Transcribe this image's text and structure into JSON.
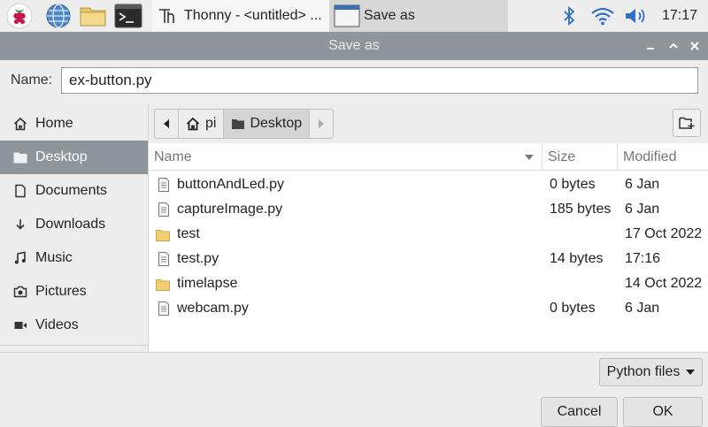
{
  "taskbar": {
    "tasks": [
      {
        "label": "Thonny  -  <untitled>  ..."
      },
      {
        "label": "Save as"
      }
    ],
    "clock": "17:17"
  },
  "dialog": {
    "title": "Save as",
    "name_label": "Name:",
    "name_value": "ex-button.py"
  },
  "sidebar": {
    "items": [
      {
        "label": "Home",
        "icon": "home-icon"
      },
      {
        "label": "Desktop",
        "icon": "folder-icon",
        "selected": true
      },
      {
        "label": "Documents",
        "icon": "document-icon"
      },
      {
        "label": "Downloads",
        "icon": "download-icon"
      },
      {
        "label": "Music",
        "icon": "music-icon"
      },
      {
        "label": "Pictures",
        "icon": "camera-icon"
      },
      {
        "label": "Videos",
        "icon": "video-icon"
      }
    ]
  },
  "path": {
    "crumbs": [
      {
        "label": "pi",
        "icon": "home-icon"
      },
      {
        "label": "Desktop",
        "icon": "folder-icon",
        "selected": true
      }
    ]
  },
  "files": {
    "columns": {
      "name": "Name",
      "size": "Size",
      "modified": "Modified"
    },
    "rows": [
      {
        "name": "buttonAndLed.py",
        "type": "file",
        "size": "0 bytes",
        "modified": "6 Jan"
      },
      {
        "name": "captureImage.py",
        "type": "file",
        "size": "185 bytes",
        "modified": "6 Jan"
      },
      {
        "name": "test",
        "type": "folder",
        "size": "",
        "modified": "17 Oct 2022"
      },
      {
        "name": "test.py",
        "type": "file",
        "size": "14 bytes",
        "modified": "17:16"
      },
      {
        "name": "timelapse",
        "type": "folder",
        "size": "",
        "modified": "14 Oct 2022"
      },
      {
        "name": "webcam.py",
        "type": "file",
        "size": "0 bytes",
        "modified": "6 Jan"
      }
    ]
  },
  "filter": {
    "label": "Python files"
  },
  "buttons": {
    "cancel": "Cancel",
    "ok": "OK"
  },
  "colors": {
    "titlebar": "#8e969c",
    "selection": "#8e969c",
    "folder": "#f2cf72"
  }
}
